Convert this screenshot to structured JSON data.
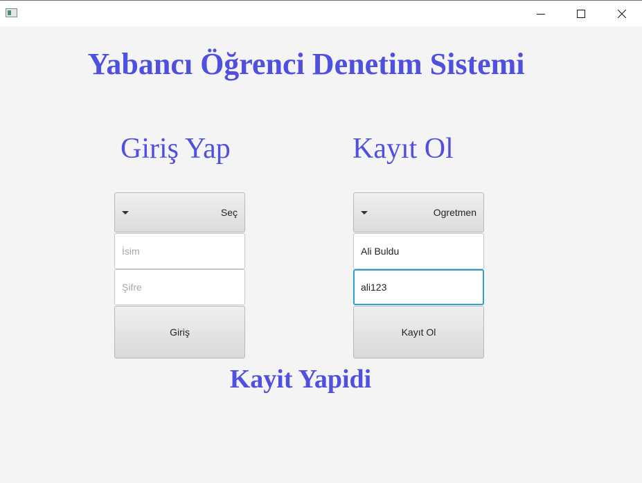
{
  "window": {
    "icon": "app-window-icon",
    "controls": {
      "minimize": "minimize-icon",
      "maximize": "maximize-icon",
      "close": "close-icon"
    }
  },
  "main_title": "Yabancı Öğrenci Denetim Sistemi",
  "login": {
    "title": "Giriş Yap",
    "role_select": "Seç",
    "name_placeholder": "İsim",
    "name_value": "",
    "password_placeholder": "Şifre",
    "password_value": "",
    "button": "Giriş"
  },
  "register": {
    "title": "Kayıt Ol",
    "role_select": "Ogretmen",
    "name_value": "Ali Buldu",
    "password_value": "ali123",
    "button": "Kayıt Ol"
  },
  "status_message": "Kayit Yapidi",
  "colors": {
    "accent": "#4f4fe0",
    "focus": "#2c9fd9",
    "background": "#f4f4f4"
  }
}
